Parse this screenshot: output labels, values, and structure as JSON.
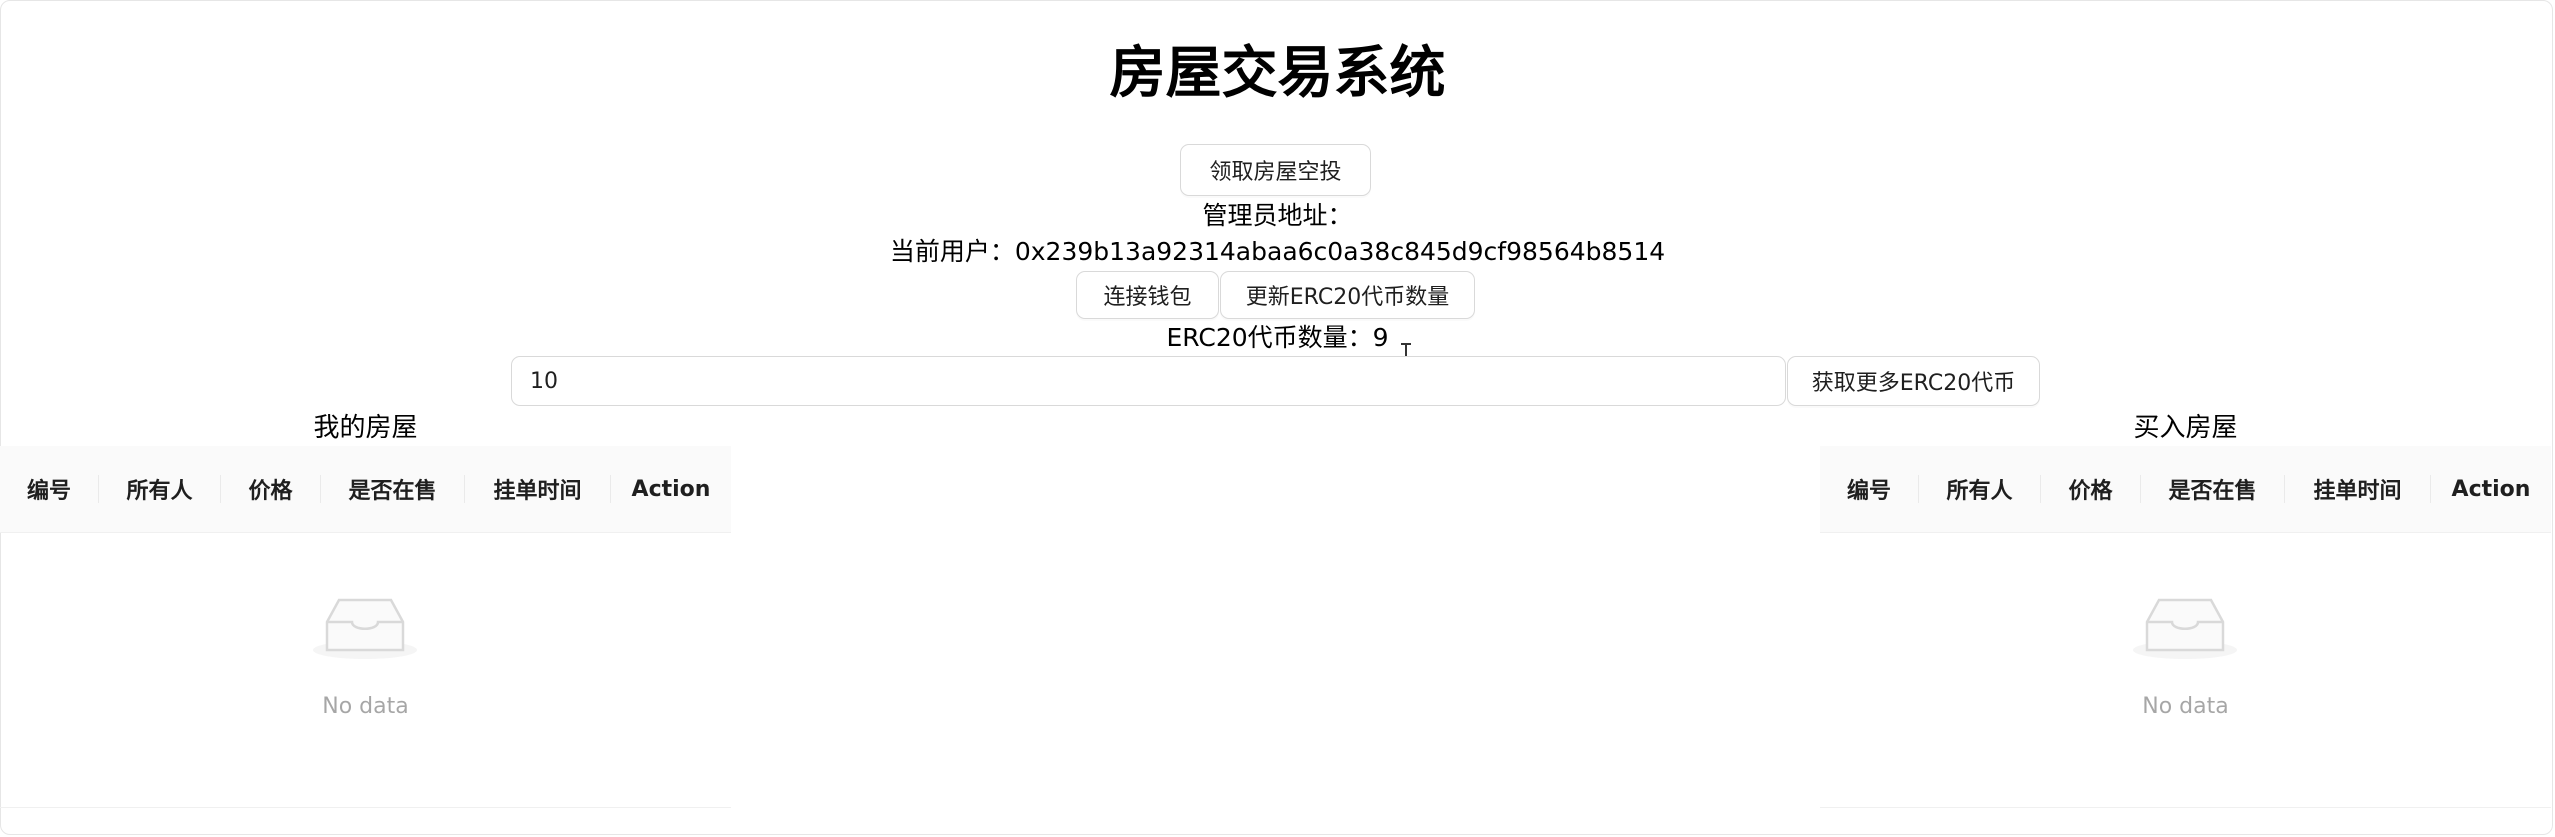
{
  "app": {
    "title": "房屋交易系统"
  },
  "airdrop_button": "领取房屋空投",
  "admin": {
    "label": "管理员地址："
  },
  "current_user": {
    "label": "当前用户：",
    "address": "0x239b13a92314abaa6c0a38c845d9cf98564b8514"
  },
  "buttons": {
    "connect_wallet": "连接钱包",
    "update_erc20": "更新ERC20代币数量",
    "get_more_erc20": "获取更多ERC20代币"
  },
  "erc20": {
    "label": "ERC20代币数量：",
    "amount": "9"
  },
  "token_input": {
    "value": "10"
  },
  "my_houses": {
    "title": "我的房屋",
    "columns": [
      "编号",
      "所有人",
      "价格",
      "是否在售",
      "挂单时间",
      "Action"
    ],
    "empty_text": "No data"
  },
  "buy_houses": {
    "title": "买入房屋",
    "columns": [
      "编号",
      "所有人",
      "价格",
      "是否在售",
      "挂单时间",
      "Action"
    ],
    "empty_text": "No data"
  },
  "icons": {
    "empty": "inbox-empty-icon",
    "cursor": "text-cursor-icon"
  },
  "colors": {
    "text": "#000000",
    "muted": "#bfbfbf",
    "border": "#d9d9d9",
    "table_header_bg": "#fafafa"
  }
}
